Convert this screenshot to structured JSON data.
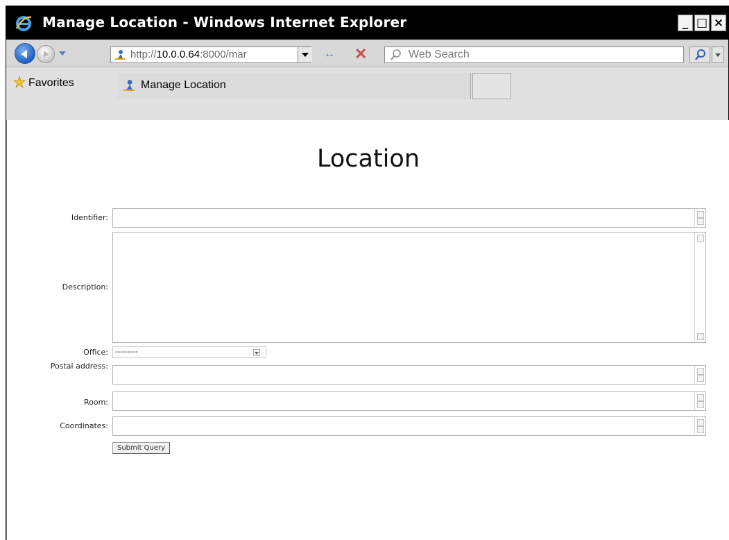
{
  "window": {
    "title": "Manage Location - Windows Internet Explorer",
    "controls": {
      "minimize": "_",
      "maximize": "□",
      "close": "×"
    }
  },
  "navbar": {
    "address_prefix": "http://",
    "address_host": "10.0.0.64",
    "address_rest": ":8000/mar",
    "search_placeholder": "Web Search",
    "back_icon": "back-arrow-icon",
    "forward_icon": "forward-arrow-icon",
    "refresh_icon": "refresh-icon",
    "stop_icon": "stop-icon"
  },
  "favorites": {
    "label": "Favorites",
    "tab_label": "Manage Location"
  },
  "page": {
    "title": "Location",
    "fields": [
      {
        "label": "Identifier:",
        "value": ""
      },
      {
        "label": "Description:",
        "value": ""
      },
      {
        "label": "Office:",
        "value": "---------"
      },
      {
        "label": "Postal address:",
        "value": ""
      },
      {
        "label": "Room:",
        "value": ""
      },
      {
        "label": "Coordinates:",
        "value": ""
      }
    ],
    "submit_label": "Submit Query"
  }
}
